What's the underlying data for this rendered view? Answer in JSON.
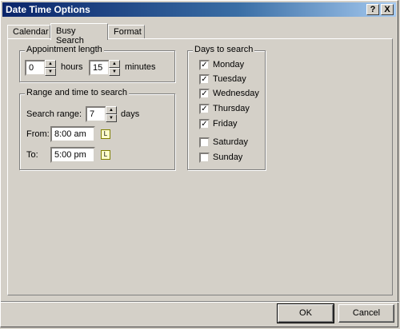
{
  "window": {
    "title": "Date Time Options",
    "help_label": "?",
    "close_label": "X"
  },
  "tabs": [
    {
      "label": "Calendar"
    },
    {
      "label": "Busy Search"
    },
    {
      "label": "Format"
    }
  ],
  "appointment": {
    "legend": "Appointment length",
    "hours_value": "0",
    "hours_label": "hours",
    "minutes_value": "15",
    "minutes_label": "minutes"
  },
  "range": {
    "legend": "Range and time to search",
    "search_range_label": "Search range:",
    "search_range_value": "7",
    "days_label": "days",
    "from_label": "From:",
    "from_value": "8:00 am",
    "to_label": "To:",
    "to_value": "5:00 pm"
  },
  "days": {
    "legend": "Days to search",
    "items": [
      {
        "label": "Monday",
        "checked": true
      },
      {
        "label": "Tuesday",
        "checked": true
      },
      {
        "label": "Wednesday",
        "checked": true
      },
      {
        "label": "Thursday",
        "checked": true
      },
      {
        "label": "Friday",
        "checked": true
      },
      {
        "label": "Saturday",
        "checked": false
      },
      {
        "label": "Sunday",
        "checked": false
      }
    ]
  },
  "buttons": {
    "ok": "OK",
    "cancel": "Cancel"
  },
  "icons": {
    "spin_up": "spin-up-arrow",
    "spin_down": "spin-down-arrow",
    "clock": "clock-icon",
    "check": "check-mark"
  },
  "colors": {
    "face": "#d4d0c8",
    "title_start": "#0a246a",
    "title_end": "#a6caf0"
  }
}
